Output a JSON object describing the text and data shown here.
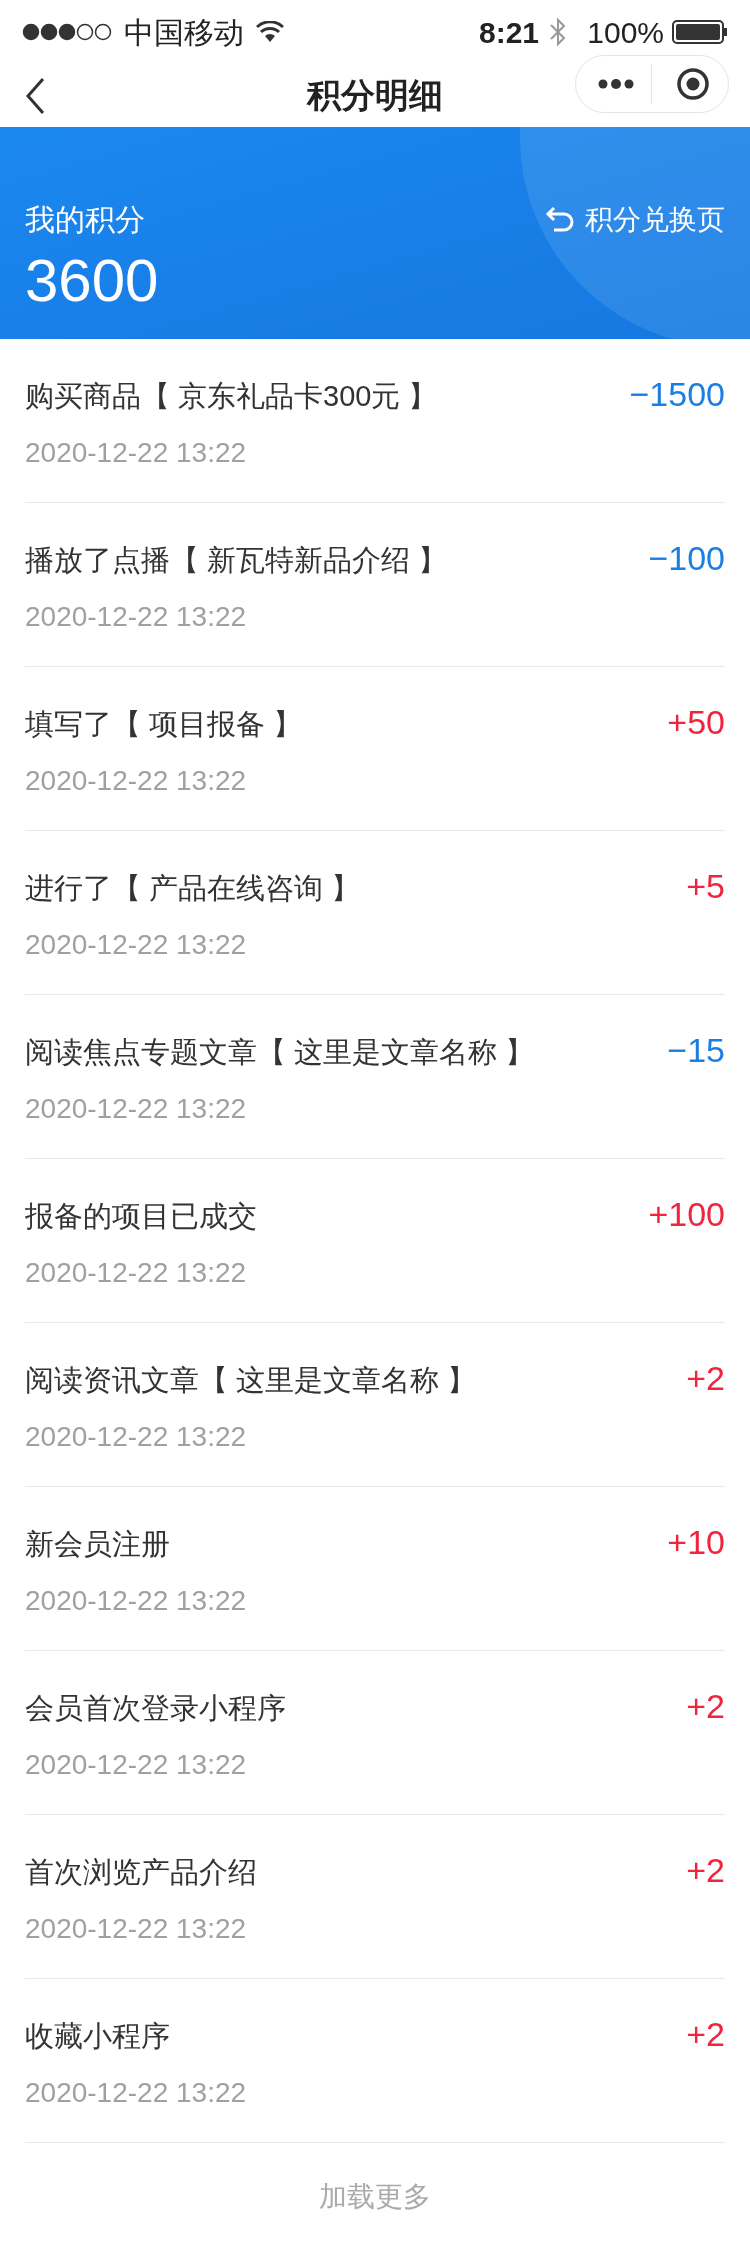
{
  "status_bar": {
    "carrier": "中国移动",
    "time": "8:21",
    "battery": "100%"
  },
  "nav": {
    "title": "积分明细"
  },
  "summary": {
    "label": "我的积分",
    "points": "3600",
    "link": "积分兑换页"
  },
  "records": [
    {
      "title": "购买商品【 京东礼品卡300元 】",
      "time": "2020-12-22 13:22",
      "amount": "−1500",
      "color": "#1a7fe0"
    },
    {
      "title": "播放了点播【 新瓦特新品介绍 】",
      "time": "2020-12-22 13:22",
      "amount": "−100",
      "color": "#1a7fe0"
    },
    {
      "title": "填写了【 项目报备 】",
      "time": "2020-12-22 13:22",
      "amount": "+50",
      "color": "#f0243c"
    },
    {
      "title": "进行了【 产品在线咨询 】",
      "time": "2020-12-22 13:22",
      "amount": "+5",
      "color": "#f0243c"
    },
    {
      "title": "阅读焦点专题文章【 这里是文章名称 】",
      "time": "2020-12-22 13:22",
      "amount": "−15",
      "color": "#1a7fe0"
    },
    {
      "title": "报备的项目已成交",
      "time": "2020-12-22 13:22",
      "amount": "+100",
      "color": "#f0243c"
    },
    {
      "title": "阅读资讯文章【 这里是文章名称 】",
      "time": "2020-12-22 13:22",
      "amount": "+2",
      "color": "#f0243c"
    },
    {
      "title": "新会员注册",
      "time": "2020-12-22 13:22",
      "amount": "+10",
      "color": "#f0243c"
    },
    {
      "title": "会员首次登录小程序",
      "time": "2020-12-22 13:22",
      "amount": "+2",
      "color": "#f0243c"
    },
    {
      "title": "首次浏览产品介绍",
      "time": "2020-12-22 13:22",
      "amount": "+2",
      "color": "#f0243c"
    },
    {
      "title": "收藏小程序",
      "time": "2020-12-22 13:22",
      "amount": "+2",
      "color": "#f0243c"
    }
  ],
  "load_more": "加载更多"
}
